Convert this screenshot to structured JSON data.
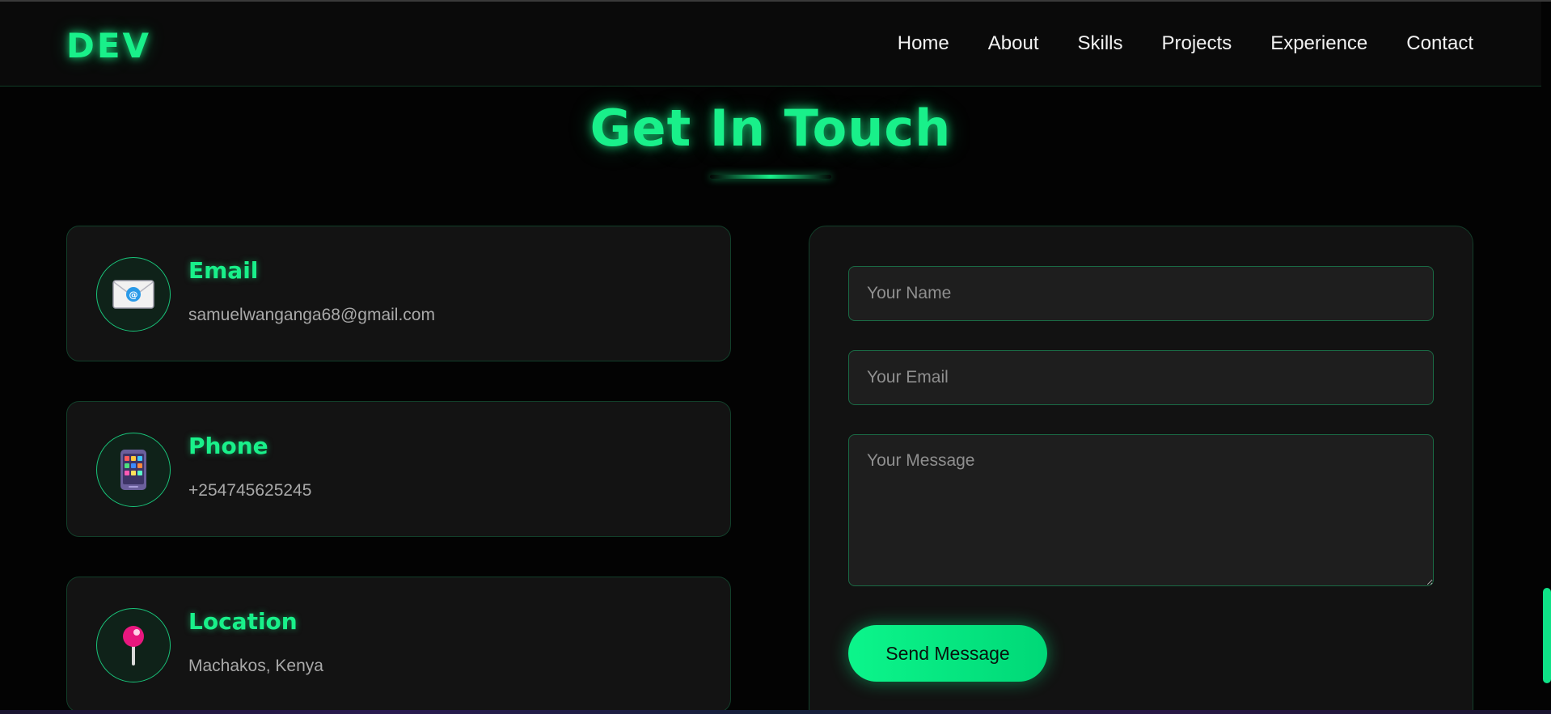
{
  "nav": {
    "logo": "DEV",
    "links": [
      "Home",
      "About",
      "Skills",
      "Projects",
      "Experience",
      "Contact"
    ]
  },
  "section": {
    "title": "Get In Touch"
  },
  "contact_info": [
    {
      "icon": "envelope-icon",
      "title": "Email",
      "value": "samuelwanganga68@gmail.com"
    },
    {
      "icon": "mobile-phone-icon",
      "title": "Phone",
      "value": "+254745625245"
    },
    {
      "icon": "map-pin-icon",
      "title": "Location",
      "value": "Machakos, Kenya"
    }
  ],
  "form": {
    "name_placeholder": "Your Name",
    "email_placeholder": "Your Email",
    "message_placeholder": "Your Message",
    "submit_label": "Send Message"
  },
  "colors": {
    "accent": "#19f08a",
    "background": "#030303",
    "card": "#131313",
    "border": "#123f2a"
  }
}
